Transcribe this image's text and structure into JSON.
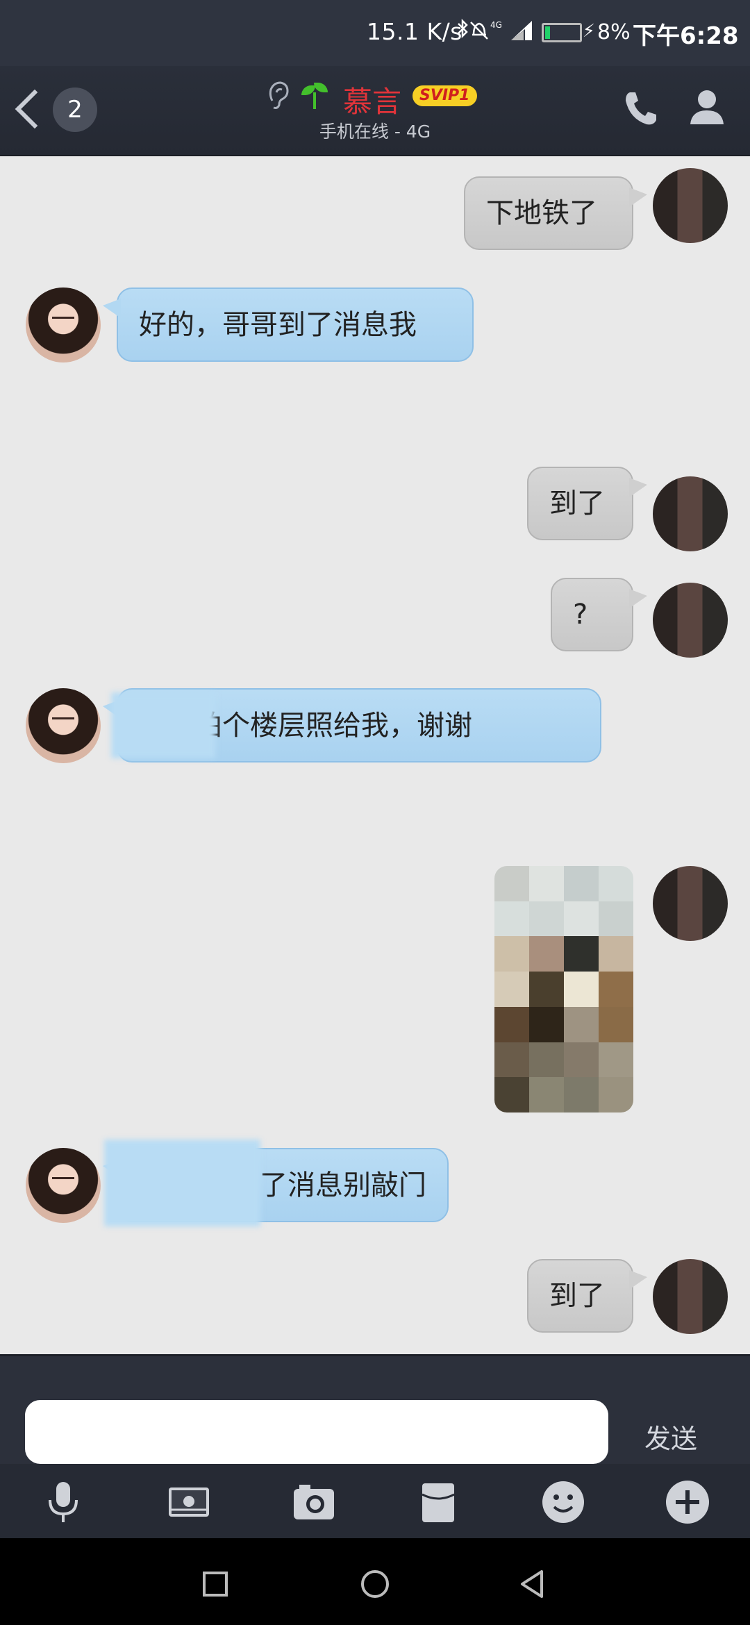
{
  "status_bar": {
    "network_speed": "15.1 K/s",
    "icons": [
      "bluetooth-icon",
      "mute-icon",
      "4g-icon",
      "signal-icon",
      "battery-icon"
    ],
    "battery_percent": "8%",
    "time": "下午6:28"
  },
  "header": {
    "unread_count": "2",
    "contact_name": "慕言",
    "vip_badge": "SVIP1",
    "online_status": "手机在线 - 4G"
  },
  "messages": [
    {
      "sender": "me",
      "type": "text",
      "text": "下地铁了"
    },
    {
      "sender": "her",
      "type": "text",
      "text": "好的，哥哥到了消息我"
    },
    {
      "sender": "me",
      "type": "text",
      "text": "到了"
    },
    {
      "sender": "me",
      "type": "text",
      "text": "?"
    },
    {
      "sender": "her",
      "type": "text",
      "text": "到了拍个楼层照给我，谢谢"
    },
    {
      "sender": "me",
      "type": "image"
    },
    {
      "sender": "her",
      "type": "text",
      "text": "了消息别敲门"
    },
    {
      "sender": "me",
      "type": "text",
      "text": "到了"
    }
  ],
  "input": {
    "value": "",
    "send_label": "发送"
  },
  "toolbar": [
    "microphone-icon",
    "picture-icon",
    "camera-icon",
    "red-packet-icon",
    "emoji-icon",
    "plus-icon"
  ],
  "nav": [
    "recents-icon",
    "home-icon",
    "back-icon"
  ],
  "colors": {
    "header_bg": "#2a2f3a",
    "name_red": "#e0343a",
    "svip_yellow": "#f7cf25",
    "bubble_blue": "#b9dcf4",
    "bubble_gray": "#cfcfcf"
  }
}
